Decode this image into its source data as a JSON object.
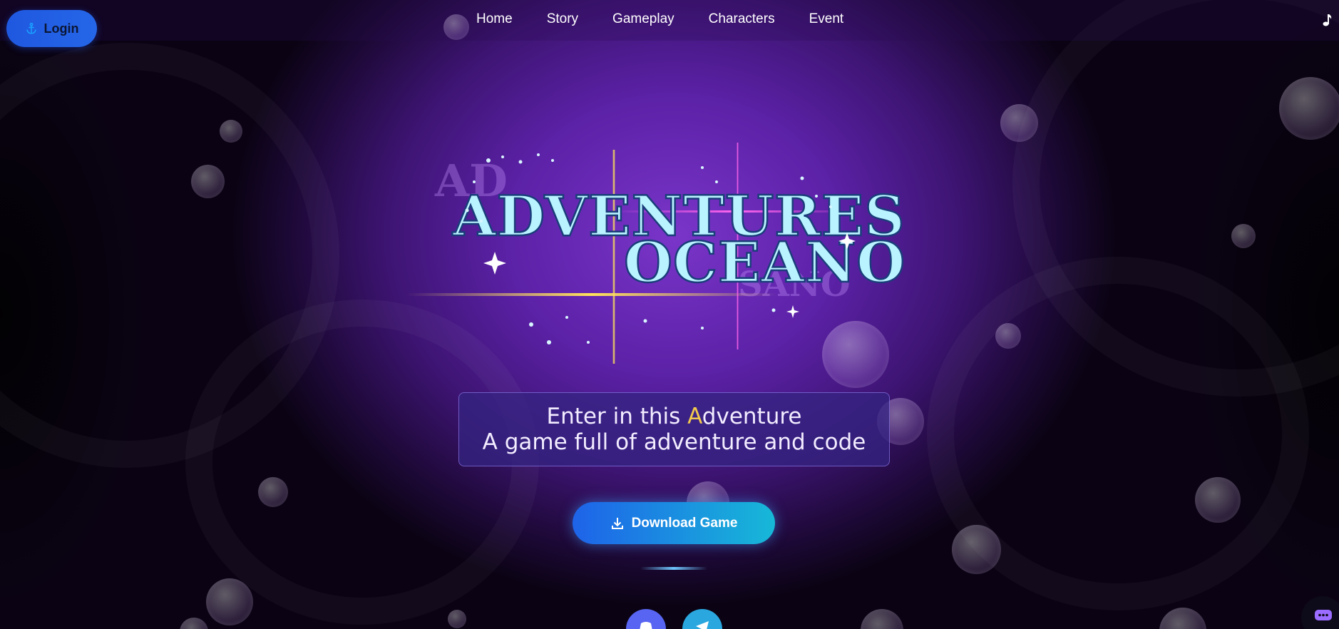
{
  "nav": {
    "login_label": "Login",
    "items": [
      "Home",
      "Story",
      "Gameplay",
      "Characters",
      "Event"
    ]
  },
  "logo": {
    "line1": "ADVENTURES",
    "line2": "OCEANO"
  },
  "tagline": {
    "line1_pre": "Enter in this ",
    "line1_accent": "A",
    "line1_post": "dventure",
    "line2": "A game full of adventure and code"
  },
  "download": {
    "label": "Download Game"
  },
  "colors": {
    "accent": "#f2c94c",
    "button_blue": "#1e63e9",
    "button_cyan": "#17b8d8",
    "discord": "#5865f2",
    "telegram": "#2aa7df"
  },
  "icons": [
    "anchor-icon",
    "music-note-icon",
    "download-icon",
    "discord-icon",
    "telegram-icon",
    "chat-icon"
  ]
}
